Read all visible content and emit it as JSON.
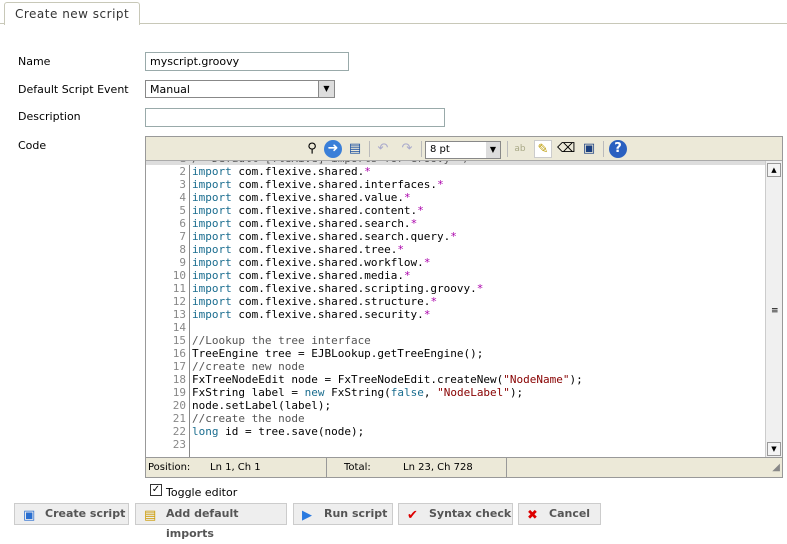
{
  "tab": {
    "label": "Create new script"
  },
  "form": {
    "name_label": "Name",
    "name_value": "myscript.groovy",
    "event_label": "Default Script Event",
    "event_value": "Manual",
    "description_label": "Description",
    "description_value": "",
    "code_label": "Code"
  },
  "editor": {
    "font_size": "8 pt",
    "toolbar_icons": [
      "search-icon",
      "goto-line-icon",
      "fullscreen-icon",
      "undo-icon",
      "redo-icon",
      "spellcheck-icon",
      "highlight-icon",
      "reset-icon",
      "word-wrap-icon",
      "help-icon"
    ],
    "lines": [
      [
        [
          "/* Default [fleXive] imports for Groovy */",
          "cm"
        ]
      ],
      [
        [
          "import",
          "kw"
        ],
        [
          " com.flexive.shared.",
          ""
        ],
        [
          "*",
          "op"
        ]
      ],
      [
        [
          "import",
          "kw"
        ],
        [
          " com.flexive.shared.interfaces.",
          ""
        ],
        [
          "*",
          "op"
        ]
      ],
      [
        [
          "import",
          "kw"
        ],
        [
          " com.flexive.shared.value.",
          ""
        ],
        [
          "*",
          "op"
        ]
      ],
      [
        [
          "import",
          "kw"
        ],
        [
          " com.flexive.shared.content.",
          ""
        ],
        [
          "*",
          "op"
        ]
      ],
      [
        [
          "import",
          "kw"
        ],
        [
          " com.flexive.shared.search.",
          ""
        ],
        [
          "*",
          "op"
        ]
      ],
      [
        [
          "import",
          "kw"
        ],
        [
          " com.flexive.shared.search.query.",
          ""
        ],
        [
          "*",
          "op"
        ]
      ],
      [
        [
          "import",
          "kw"
        ],
        [
          " com.flexive.shared.tree.",
          ""
        ],
        [
          "*",
          "op"
        ]
      ],
      [
        [
          "import",
          "kw"
        ],
        [
          " com.flexive.shared.workflow.",
          ""
        ],
        [
          "*",
          "op"
        ]
      ],
      [
        [
          "import",
          "kw"
        ],
        [
          " com.flexive.shared.media.",
          ""
        ],
        [
          "*",
          "op"
        ]
      ],
      [
        [
          "import",
          "kw"
        ],
        [
          " com.flexive.shared.scripting.groovy.",
          ""
        ],
        [
          "*",
          "op"
        ]
      ],
      [
        [
          "import",
          "kw"
        ],
        [
          " com.flexive.shared.structure.",
          ""
        ],
        [
          "*",
          "op"
        ]
      ],
      [
        [
          "import",
          "kw"
        ],
        [
          " com.flexive.shared.security.",
          ""
        ],
        [
          "*",
          "op"
        ]
      ],
      [],
      [
        [
          "//Lookup the tree interface",
          "cm"
        ]
      ],
      [
        [
          "TreeEngine tree = EJBLookup.getTreeEngine();",
          ""
        ]
      ],
      [
        [
          "//create new node",
          "cm"
        ]
      ],
      [
        [
          "FxTreeNodeEdit node = FxTreeNodeEdit.createNew(",
          ""
        ],
        [
          "\"NodeName\"",
          "str"
        ],
        [
          ");",
          ""
        ]
      ],
      [
        [
          "FxString label = ",
          ""
        ],
        [
          "new",
          "kw"
        ],
        [
          " FxString(",
          ""
        ],
        [
          "false",
          "kw"
        ],
        [
          ", ",
          ""
        ],
        [
          "\"NodeLabel\"",
          "str"
        ],
        [
          ");",
          ""
        ]
      ],
      [
        [
          "node.setLabel(label);",
          ""
        ]
      ],
      [
        [
          "//create the node",
          "cm"
        ]
      ],
      [
        [
          "long",
          "kw"
        ],
        [
          " id = tree.save(node);",
          ""
        ]
      ],
      []
    ],
    "status": {
      "position_label": "Position:",
      "position_value": "Ln 1, Ch 1",
      "total_label": "Total:",
      "total_value": "Ln 23, Ch 728"
    }
  },
  "toggle": {
    "label": "Toggle editor",
    "checked": true
  },
  "buttons": [
    {
      "label": "Create script",
      "icon": "save-icon"
    },
    {
      "label": "Add default imports",
      "icon": "imports-icon"
    },
    {
      "label": "Run script",
      "icon": "play-icon"
    },
    {
      "label": "Syntax check",
      "icon": "syntax-check-icon"
    },
    {
      "label": "Cancel",
      "icon": "cancel-icon"
    }
  ]
}
